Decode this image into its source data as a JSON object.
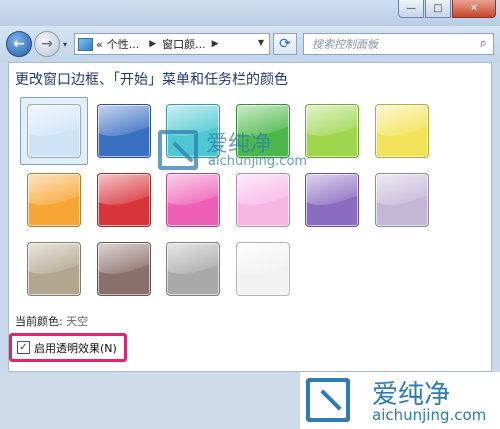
{
  "window": {
    "minimize_glyph": "—",
    "maximize_glyph": "□",
    "close_glyph": "✕"
  },
  "nav": {
    "back_glyph": "←",
    "forward_glyph": "→",
    "history_glyph": "▾",
    "breadcrumb": [
      "«",
      "个性...",
      "窗口颜..."
    ],
    "refresh_glyph": "⟳",
    "search_placeholder": "搜索控制面板"
  },
  "page": {
    "heading": "更改窗口边框、「开始」菜单和任务栏的颜色",
    "current_color_label": "当前颜色:",
    "current_color_value": "天空",
    "transparency_label": "启用透明效果(N)",
    "transparency_checked": true
  },
  "swatches": [
    {
      "color": "#cfe3f8",
      "selected": true
    },
    {
      "color": "#3b6fc2"
    },
    {
      "color": "#4ec7d2"
    },
    {
      "color": "#4db84a"
    },
    {
      "color": "#9ed64e"
    },
    {
      "color": "#f1e35a"
    },
    {
      "color": "#f7a534"
    },
    {
      "color": "#d8353a"
    },
    {
      "color": "#ee5fb6"
    },
    {
      "color": "#f6b7e6"
    },
    {
      "color": "#8b6cc1"
    },
    {
      "color": "#c3b6d7"
    },
    {
      "color": "#b3a68e"
    },
    {
      "color": "#8a6f6a"
    },
    {
      "color": "#a9a9a9"
    },
    {
      "color": "#f2f2f2"
    }
  ],
  "watermark": {
    "name": "爱纯净",
    "domain": "aichunjing.com"
  }
}
